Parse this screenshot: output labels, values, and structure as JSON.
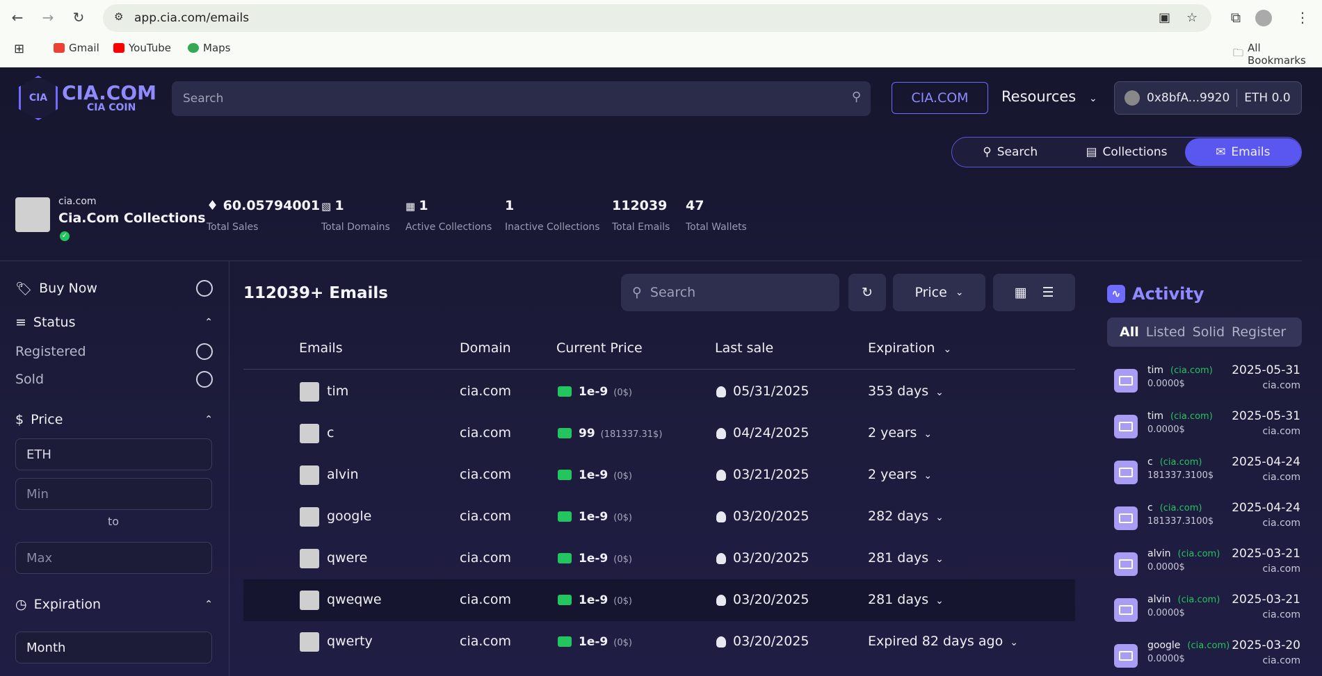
{
  "browser": {
    "url": "app.cia.com/emails",
    "bookmarks": [
      "Gmail",
      "YouTube",
      "Maps"
    ],
    "all_bookmarks": "All Bookmarks"
  },
  "header": {
    "logo_main": "CIA.COM",
    "logo_sub": "CIA COIN",
    "logo_mark": "CIA",
    "search_placeholder": "Search",
    "cia_button": "CIA.COM",
    "resources": "Resources",
    "wallet_address": "0x8bfA...9920",
    "wallet_balance": "ETH 0.0"
  },
  "segment": {
    "items": [
      {
        "label": "Search",
        "icon": "search-icon"
      },
      {
        "label": "Collections",
        "icon": "collections-icon"
      },
      {
        "label": "Emails",
        "icon": "email-icon"
      }
    ],
    "active": "Emails"
  },
  "collection": {
    "domain": "cia.com",
    "name": "Cia.Com Collections",
    "stats": [
      {
        "value": "60.05794001",
        "label": "Total Sales"
      },
      {
        "value": "1",
        "label": "Total Domains"
      },
      {
        "value": "1",
        "label": "Active Collections"
      },
      {
        "value": "1",
        "label": "Inactive Collections"
      },
      {
        "value": "112039",
        "label": "Total Emails"
      },
      {
        "value": "47",
        "label": "Total Wallets"
      }
    ]
  },
  "filters": {
    "buy_now": "Buy Now",
    "status": "Status",
    "registered": "Registered",
    "sold": "Sold",
    "price": "Price",
    "currency": "ETH",
    "min_placeholder": "Min",
    "to": "to",
    "max_placeholder": "Max",
    "expiration": "Expiration",
    "expiration_value": "Month"
  },
  "main": {
    "title": "112039+ Emails",
    "search_placeholder": "Search",
    "sort_label": "Price",
    "columns": [
      "Emails",
      "Domain",
      "Current Price",
      "Last sale",
      "Expiration"
    ],
    "rows": [
      {
        "email": "tim",
        "domain": "cia.com",
        "price": "1e-9",
        "price_usd": "(0$)",
        "last_sale": "05/31/2025",
        "expiration": "353 days"
      },
      {
        "email": "c",
        "domain": "cia.com",
        "price": "99",
        "price_usd": "(181337.31$)",
        "last_sale": "04/24/2025",
        "expiration": "2 years"
      },
      {
        "email": "alvin",
        "domain": "cia.com",
        "price": "1e-9",
        "price_usd": "(0$)",
        "last_sale": "03/21/2025",
        "expiration": "2 years"
      },
      {
        "email": "google",
        "domain": "cia.com",
        "price": "1e-9",
        "price_usd": "(0$)",
        "last_sale": "03/20/2025",
        "expiration": "282 days"
      },
      {
        "email": "qwere",
        "domain": "cia.com",
        "price": "1e-9",
        "price_usd": "(0$)",
        "last_sale": "03/20/2025",
        "expiration": "281 days"
      },
      {
        "email": "qweqwe",
        "domain": "cia.com",
        "price": "1e-9",
        "price_usd": "(0$)",
        "last_sale": "03/20/2025",
        "expiration": "281 days"
      },
      {
        "email": "qwerty",
        "domain": "cia.com",
        "price": "1e-9",
        "price_usd": "(0$)",
        "last_sale": "03/20/2025",
        "expiration": "Expired 82 days ago"
      }
    ]
  },
  "activity": {
    "title": "Activity",
    "tabs": [
      "All",
      "Listed",
      "Solid",
      "Register"
    ],
    "items": [
      {
        "name": "tim",
        "domain": "(cia.com)",
        "value": "0.0000$",
        "date": "2025-05-31",
        "sub": "cia.com"
      },
      {
        "name": "tim",
        "domain": "(cia.com)",
        "value": "0.0000$",
        "date": "2025-05-31",
        "sub": "cia.com"
      },
      {
        "name": "c",
        "domain": "(cia.com)",
        "value": "181337.3100$",
        "date": "2025-04-24",
        "sub": "cia.com"
      },
      {
        "name": "c",
        "domain": "(cia.com)",
        "value": "181337.3100$",
        "date": "2025-04-24",
        "sub": "cia.com"
      },
      {
        "name": "alvin",
        "domain": "(cia.com)",
        "value": "0.0000$",
        "date": "2025-03-21",
        "sub": "cia.com"
      },
      {
        "name": "alvin",
        "domain": "(cia.com)",
        "value": "0.0000$",
        "date": "2025-03-21",
        "sub": "cia.com"
      },
      {
        "name": "google",
        "domain": "(cia.com)",
        "value": "0.0000$",
        "date": "2025-03-20",
        "sub": "cia.com"
      }
    ]
  }
}
